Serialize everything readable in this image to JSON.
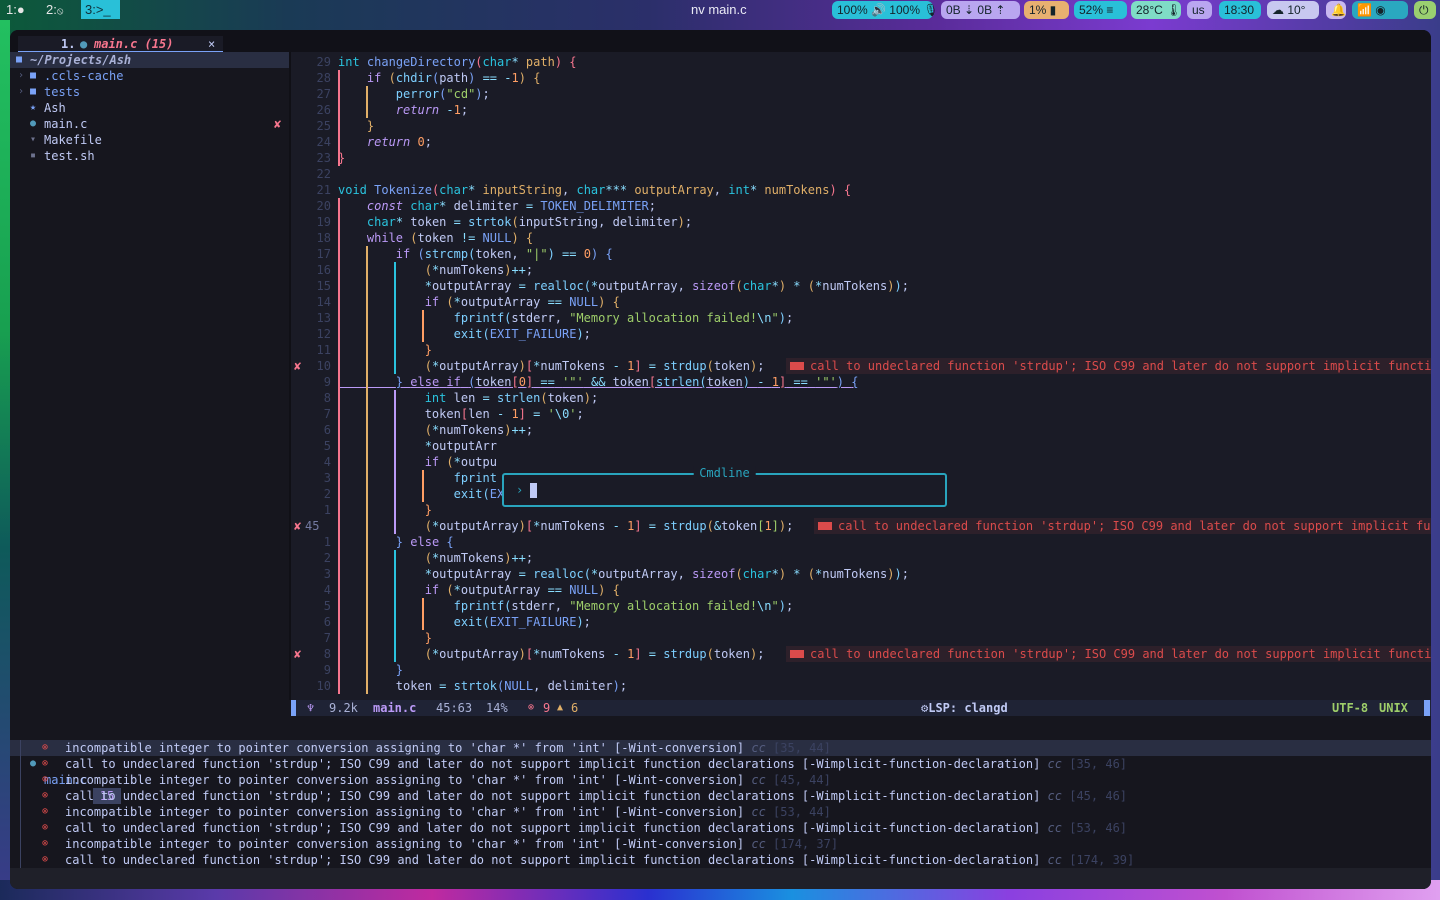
{
  "topbar": {
    "workspaces": [
      {
        "label": "1:",
        "icon": "●"
      },
      {
        "label": "2:",
        "icon": "⦸"
      },
      {
        "label": "3:",
        "icon": ">_",
        "active": true
      }
    ],
    "window_title": "nv main.c",
    "modules": [
      {
        "name": "audio",
        "text": "100% 🔊 100% 🎙",
        "color": "#29c0d8"
      },
      {
        "name": "network-traffic",
        "text": "0B ⇣   0B ⇡",
        "color": "#b9a6f0"
      },
      {
        "name": "cpu",
        "text": "1% ▮",
        "color": "#e8b070"
      },
      {
        "name": "memory",
        "text": "52% ≡",
        "color": "#29c0d8"
      },
      {
        "name": "temperature",
        "text": "28°C 🌡",
        "color": "#7fdcc6"
      },
      {
        "name": "keyboard-layout",
        "text": "us",
        "color": "#b9a6f0"
      },
      {
        "name": "clock",
        "text": "18:30",
        "color": "#29c0d8"
      },
      {
        "name": "weather",
        "text": "☁  10°",
        "color": "#c8c8f0"
      },
      {
        "name": "notifications",
        "text": "🔔",
        "color": "#c8b8f0"
      },
      {
        "name": "tray",
        "text": "📶 ◉",
        "color": "#2aa8c0"
      },
      {
        "name": "power",
        "text": "⏻",
        "color": "#9ad070"
      }
    ]
  },
  "tabline": {
    "tabs": [
      {
        "number": "1.",
        "icon": "c-file-icon",
        "label": "main.c (15)",
        "close": "×"
      }
    ]
  },
  "tree": {
    "root": "~/Projects/Ash",
    "items": [
      {
        "label": ".ccls-cache",
        "type": "dir",
        "icon": "folder-icon"
      },
      {
        "label": "tests",
        "type": "dir",
        "icon": "folder-icon"
      },
      {
        "label": "Ash",
        "type": "file",
        "icon": "star-icon"
      },
      {
        "label": "main.c",
        "type": "file",
        "icon": "c-file-icon",
        "error": "✘"
      },
      {
        "label": "Makefile",
        "type": "file",
        "icon": "makefile-icon"
      },
      {
        "label": "test.sh",
        "type": "file",
        "icon": "shell-icon"
      }
    ]
  },
  "editor": {
    "lines": [
      {
        "n": "29",
        "html": "<span class='ty'>int</span> <span class='fn'>changeDirectory</span><span class='br1'>(</span><span class='ty'>char</span><span class='op'>*</span> <span class='pa'>path</span><span class='br1'>)</span> <span class='br1'>{</span>"
      },
      {
        "n": "28",
        "html": "    <span class='kw'>if</span> <span class='br2'>(</span><span class='cf'>chdir</span><span class='br3'>(</span>path<span class='br3'>)</span> <span class='op'>==</span> <span class='op'>-</span><span class='nu'>1</span><span class='br2'>)</span> <span class='br2'>{</span>"
      },
      {
        "n": "27",
        "html": "        <span class='cf'>perror</span><span class='br3'>(</span><span class='st'>\"cd\"</span><span class='br3'>)</span>;"
      },
      {
        "n": "26",
        "html": "        <span class='kw it'>return</span> <span class='op'>-</span><span class='nu'>1</span>;"
      },
      {
        "n": "25",
        "html": "    <span class='br2'>}</span>"
      },
      {
        "n": "24",
        "html": "    <span class='kw it'>return</span> <span class='nu'>0</span>;"
      },
      {
        "n": "23",
        "html": "<span class='br1'>}</span>"
      },
      {
        "n": "22",
        "html": ""
      },
      {
        "n": "21",
        "html": "<span class='ty'>void</span> <span class='fn'>Tokenize</span><span class='br1'>(</span><span class='ty'>char</span><span class='op'>*</span> <span class='pa'>inputString</span>, <span class='ty'>char</span><span class='op'>***</span> <span class='pa'>outputArray</span>, <span class='ty'>int</span><span class='op'>*</span> <span class='pa'>numTokens</span><span class='br1'>)</span> <span class='br1'>{</span>"
      },
      {
        "n": "20",
        "html": "    <span class='kw it'>const</span> <span class='ty'>char</span><span class='op'>*</span> delimiter <span class='op'>=</span> <span class='fn'>TOKEN_DELIMITER</span>;"
      },
      {
        "n": "19",
        "html": "    <span class='ty'>char</span><span class='op'>*</span> token <span class='op'>=</span> <span class='cf'>strtok</span><span class='br2'>(</span>inputString, delimiter<span class='br2'>)</span>;"
      },
      {
        "n": "18",
        "html": "    <span class='kw'>while</span> <span class='br2'>(</span>token <span class='op'>!=</span> <span class='fn'>NULL</span><span class='br2'>)</span> <span class='br2'>{</span>"
      },
      {
        "n": "17",
        "html": "        <span class='kw'>if</span> <span class='br3'>(</span><span class='cf'>strcmp</span><span class='br4'>(</span>token, <span class='st'>\"|\"</span><span class='br4'>)</span> <span class='op'>==</span> <span class='nu'>0</span><span class='br3'>)</span> <span class='br3'>{</span>"
      },
      {
        "n": "16",
        "html": "            <span class='pa'>(</span><span class='op'>*</span>numTokens<span class='pa'>)</span><span class='op'>++</span>;"
      },
      {
        "n": "15",
        "html": "            <span class='op'>*</span>outputArray <span class='op'>=</span> <span class='cf'>realloc</span><span class='br4'>(</span><span class='op'>*</span>outputArray, <span class='kw'>sizeof</span><span class='br2'>(</span><span class='ty'>char</span><span class='op'>*</span><span class='br2'>)</span> <span class='op'>*</span> <span class='br2'>(</span><span class='op'>*</span>numTokens<span class='br2'>)</span><span class='br4'>)</span>;"
      },
      {
        "n": "14",
        "html": "            <span class='kw'>if</span> <span class='br2'>(</span><span class='op'>*</span>outputArray <span class='op'>==</span> <span class='fn'>NULL</span><span class='br2'>)</span> <span class='br2'>{</span>"
      },
      {
        "n": "13",
        "html": "                <span class='cf'>fprintf</span><span class='br4'>(</span>stderr, <span class='st'>\"Memory allocation failed!<span class='op'>\\n</span>\"</span><span class='br4'>)</span>;"
      },
      {
        "n": "12",
        "html": "                <span class='cf'>exit</span><span class='br4'>(</span><span class='fn'>EXIT_FAILURE</span><span class='br4'>)</span>;"
      },
      {
        "n": "11",
        "html": "            <span class='nu'>}</span>"
      },
      {
        "n": "10",
        "x": true,
        "html": "            <span class='pa'>(</span><span class='op'>*</span>outputArray<span class='pa'>)</span><span class='br1'>[</span><span class='op'>*</span>numTokens <span class='op'>-</span> <span class='nu'>1</span><span class='br1'>]</span> <span class='op'>=</span> <span class='cf'>strdup</span><span class='pa'>(</span>token<span class='pa'>)</span>;",
        "vt": "call to undeclared function 'strdup'; ISO C99 and later do not support implicit function"
      },
      {
        "n": "9",
        "html": "        <span class='br3'>}</span> <span class='kw'>else</span> <span class='kw'>if</span> <span class='br3'>(</span>token<span class='br1'>[</span><span class='nu'>0</span><span class='br1'>]</span> <span class='op'>==</span> <span class='st'>'\"'</span> <span class='op'>&amp;&amp;</span> token<span class='br1'>[</span><span class='cf'>strlen</span><span class='br4'>(</span>token<span class='br4'>)</span> <span class='op'>-</span> <span class='nu'>1</span><span class='br1'>]</span> <span class='op'>==</span> <span class='st'>'\"'</span><span class='br3'>)</span> <span class='br3'>{</span>",
        "underline": true
      },
      {
        "n": "8",
        "html": "            <span class='ty'>int</span> len <span class='op'>=</span> <span class='cf'>strlen</span><span class='br2'>(</span>token<span class='br2'>)</span>;"
      },
      {
        "n": "7",
        "html": "            token<span class='br1'>[</span>len <span class='op'>-</span> <span class='nu'>1</span><span class='br1'>]</span> <span class='op'>=</span> <span class='st'>'<span class='op'>\\0</span>'</span>;"
      },
      {
        "n": "6",
        "html": "            <span class='pa'>(</span><span class='op'>*</span>numTokens<span class='pa'>)</span><span class='op'>++</span>;"
      },
      {
        "n": "5",
        "html": "            <span class='op'>*</span>outputArr"
      },
      {
        "n": "4",
        "html": "            <span class='kw'>if</span> <span class='br2'>(</span><span class='op'>*</span>outpu"
      },
      {
        "n": "3",
        "html": "                <span class='cf'>fprint</span>"
      },
      {
        "n": "2",
        "html": "                <span class='cf'>exit</span><span class='br4'>(</span><span class='fn'>EXIT_FAILURE</span><span class='br4'>)</span>;"
      },
      {
        "n": "1",
        "html": "            <span class='nu'>}</span>"
      },
      {
        "n": "45",
        "x": true,
        "current": true,
        "html": "            <span class='pa'>(</span><span class='op'>*</span>outputArray<span class='pa'>)</span><span class='br1'>[</span><span class='op'>*</span>numTokens <span class='op'>-</span> <span class='nu'>1</span><span class='br1'>]</span> <span class='op'>=</span> <span class='cf'>strdup</span><span class='pa'>(</span><span class='op'>&amp;</span>token<span class='br6'>[</span><span class='nu'>1</span><span class='br6'>]</span><span class='pa'>)</span>;",
        "vt": "call to undeclared function 'strdup'; ISO C99 and later do not support implicit funct"
      },
      {
        "n": "1",
        "html": "        <span class='br3'>}</span> <span class='kw'>else</span> <span class='br3'>{</span>"
      },
      {
        "n": "2",
        "html": "            <span class='pa'>(</span><span class='op'>*</span>numTokens<span class='pa'>)</span><span class='op'>++</span>;"
      },
      {
        "n": "3",
        "html": "            <span class='op'>*</span>outputArray <span class='op'>=</span> <span class='cf'>realloc</span><span class='br4'>(</span><span class='op'>*</span>outputArray, <span class='kw'>sizeof</span><span class='br2'>(</span><span class='ty'>char</span><span class='op'>*</span><span class='br2'>)</span> <span class='op'>*</span> <span class='br2'>(</span><span class='op'>*</span>numTokens<span class='br2'>)</span><span class='br4'>)</span>;"
      },
      {
        "n": "4",
        "html": "            <span class='kw'>if</span> <span class='br2'>(</span><span class='op'>*</span>outputArray <span class='op'>==</span> <span class='fn'>NULL</span><span class='br2'>)</span> <span class='br2'>{</span>"
      },
      {
        "n": "5",
        "html": "                <span class='cf'>fprintf</span><span class='br4'>(</span>stderr, <span class='st'>\"Memory allocation failed!<span class='op'>\\n</span>\"</span><span class='br4'>)</span>;"
      },
      {
        "n": "6",
        "html": "                <span class='cf'>exit</span><span class='br4'>(</span><span class='fn'>EXIT_FAILURE</span><span class='br4'>)</span>;"
      },
      {
        "n": "7",
        "html": "            <span class='nu'>}</span>"
      },
      {
        "n": "8",
        "x": true,
        "html": "            <span class='pa'>(</span><span class='op'>*</span>outputArray<span class='pa'>)</span><span class='br1'>[</span><span class='op'>*</span>numTokens <span class='op'>-</span> <span class='nu'>1</span><span class='br1'>]</span> <span class='op'>=</span> <span class='cf'>strdup</span><span class='pa'>(</span>token<span class='pa'>)</span>;",
        "vt": "call to undeclared function 'strdup'; ISO C99 and later do not support implicit function"
      },
      {
        "n": "9",
        "html": "        <span class='br3'>}</span>"
      },
      {
        "n": "10",
        "html": "        token <span class='op'>=</span> <span class='cf'>strtok</span><span class='br3'>(</span><span class='fn'>NULL</span>, delimiter<span class='br3'>)</span>;"
      }
    ],
    "error_sign": "✘"
  },
  "cmdline": {
    "title": "Cmdline",
    "prompt": "›",
    "value": ""
  },
  "statusline": {
    "mode_icon": "♆",
    "size": "9.2k",
    "filename": "main.c",
    "position": "45:63",
    "percent": "14%",
    "errors_icon": "⊗",
    "errors": "9",
    "warnings_icon": "▲",
    "warnings": "6",
    "lsp": "⚙LSP: clangd",
    "encoding": "UTF-8",
    "format": "UNIX"
  },
  "diagnostics": {
    "file": "main.c",
    "count": "15",
    "items": [
      {
        "message": "incompatible integer to pointer conversion assigning to 'char *' from 'int' [-Wint-conversion]",
        "source": "cc",
        "pos": "[35, 44]"
      },
      {
        "message": "call to undeclared function 'strdup'; ISO C99 and later do not support implicit function declarations [-Wimplicit-function-declaration]",
        "source": "cc",
        "pos": "[35, 46]"
      },
      {
        "message": "incompatible integer to pointer conversion assigning to 'char *' from 'int' [-Wint-conversion]",
        "source": "cc",
        "pos": "[45, 44]"
      },
      {
        "message": "call to undeclared function 'strdup'; ISO C99 and later do not support implicit function declarations [-Wimplicit-function-declaration]",
        "source": "cc",
        "pos": "[45, 46]"
      },
      {
        "message": "incompatible integer to pointer conversion assigning to 'char *' from 'int' [-Wint-conversion]",
        "source": "cc",
        "pos": "[53, 44]"
      },
      {
        "message": "call to undeclared function 'strdup'; ISO C99 and later do not support implicit function declarations [-Wimplicit-function-declaration]",
        "source": "cc",
        "pos": "[53, 46]"
      },
      {
        "message": "incompatible integer to pointer conversion assigning to 'char *' from 'int' [-Wint-conversion]",
        "source": "cc",
        "pos": "[174, 37]"
      },
      {
        "message": "call to undeclared function 'strdup'; ISO C99 and later do not support implicit function declarations [-Wimplicit-function-declaration]",
        "source": "cc",
        "pos": "[174, 39]"
      }
    ]
  }
}
